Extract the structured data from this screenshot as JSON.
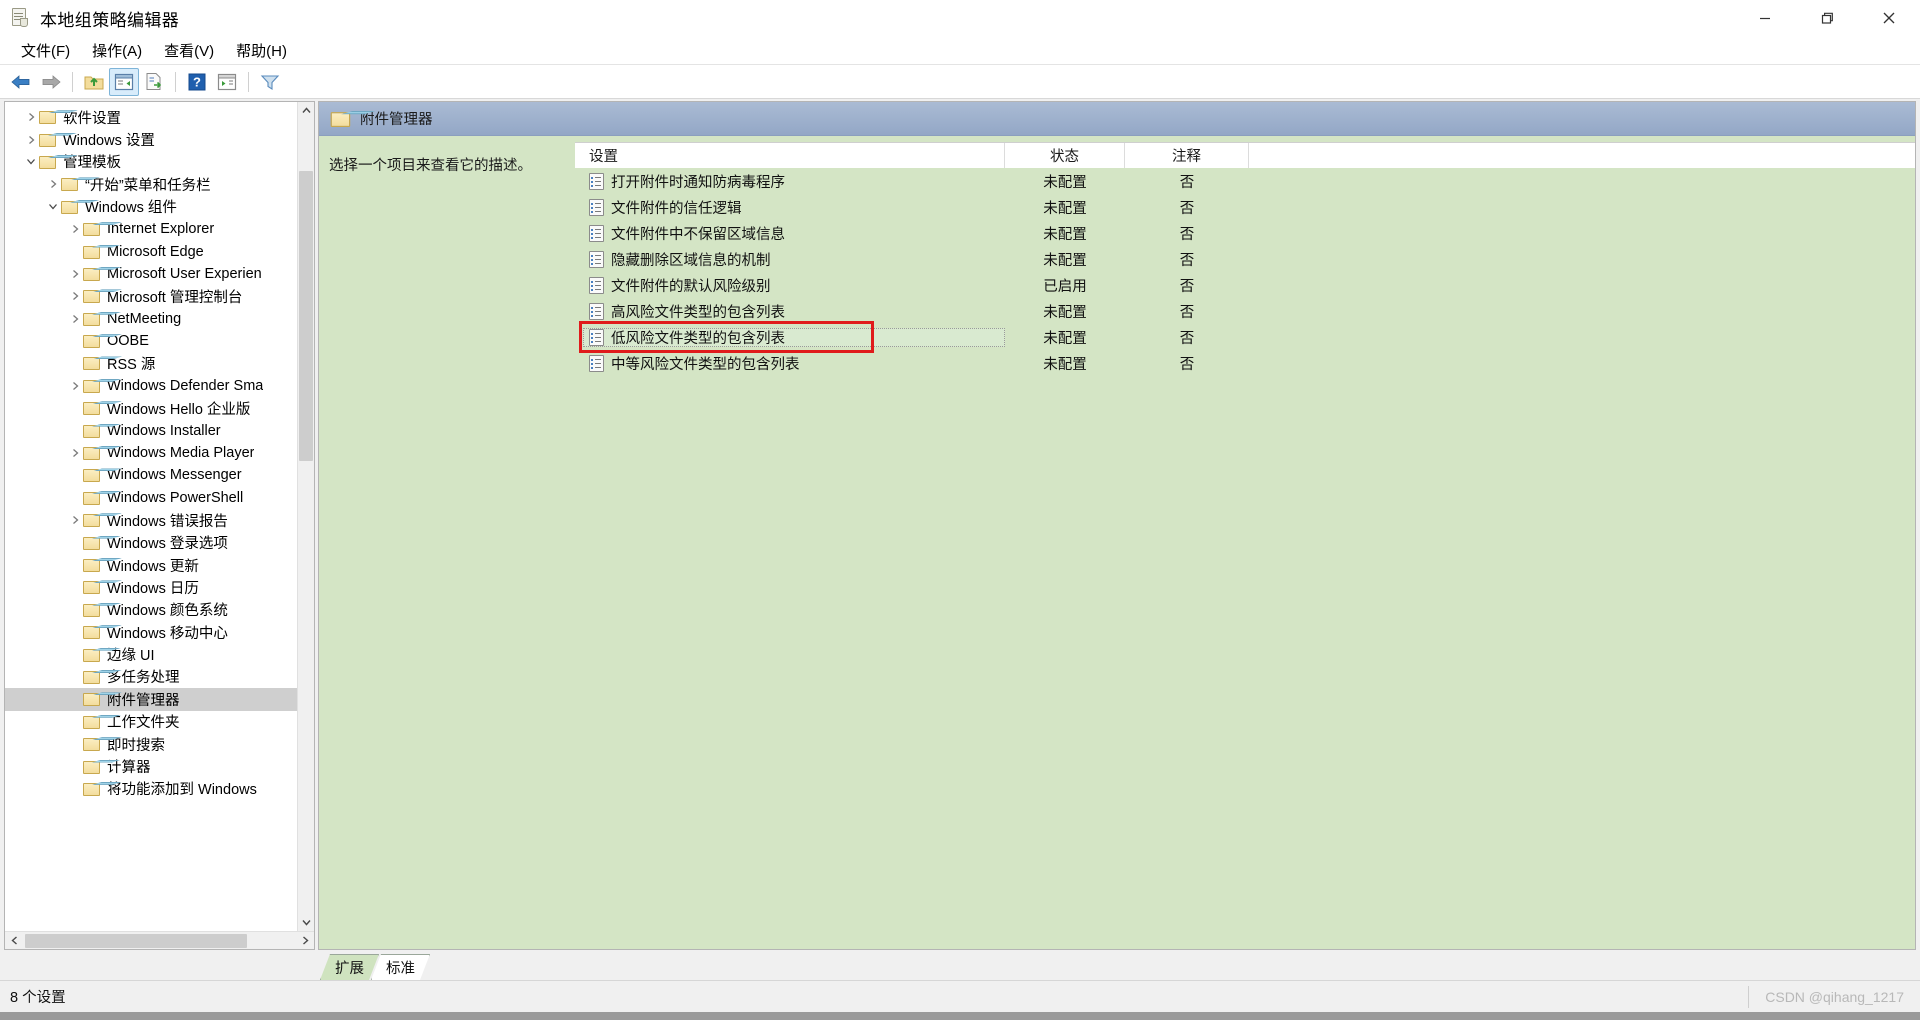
{
  "window": {
    "title": "本地组策略编辑器",
    "icon": "policy-document-icon",
    "minimize_label": "最小化",
    "maximize_label": "还原",
    "close_label": "关闭"
  },
  "menu": {
    "items": [
      {
        "label": "文件(F)",
        "name": "menu-file"
      },
      {
        "label": "操作(A)",
        "name": "menu-action"
      },
      {
        "label": "查看(V)",
        "name": "menu-view"
      },
      {
        "label": "帮助(H)",
        "name": "menu-help"
      }
    ]
  },
  "toolbar": {
    "buttons": [
      {
        "name": "back-button",
        "icon": "arrow-left-icon",
        "active": false
      },
      {
        "name": "forward-button",
        "icon": "arrow-right-icon",
        "active": false
      },
      {
        "name": "up-folder-button",
        "icon": "folder-up-icon",
        "active": false
      },
      {
        "name": "show-hide-tree-button",
        "icon": "console-tree-icon",
        "active": true
      },
      {
        "name": "export-list-button",
        "icon": "export-list-icon",
        "active": false
      },
      {
        "name": "help-button",
        "icon": "question-mark-icon",
        "active": false
      },
      {
        "name": "show-pane-button",
        "icon": "show-pane-icon",
        "active": false
      },
      {
        "name": "filter-button",
        "icon": "filter-funnel-icon",
        "active": false
      }
    ]
  },
  "tree": {
    "nodes": [
      {
        "label": "软件设置",
        "indent": 1,
        "twisty": "collapsed",
        "selected": false
      },
      {
        "label": "Windows 设置",
        "indent": 1,
        "twisty": "collapsed",
        "selected": false
      },
      {
        "label": "管理模板",
        "indent": 1,
        "twisty": "expanded",
        "selected": false
      },
      {
        "label": "“开始”菜单和任务栏",
        "indent": 2,
        "twisty": "collapsed",
        "selected": false
      },
      {
        "label": "Windows 组件",
        "indent": 2,
        "twisty": "expanded",
        "selected": false
      },
      {
        "label": "Internet Explorer",
        "indent": 3,
        "twisty": "collapsed",
        "selected": false
      },
      {
        "label": "Microsoft Edge",
        "indent": 3,
        "twisty": "none",
        "selected": false
      },
      {
        "label": "Microsoft User Experien",
        "indent": 3,
        "twisty": "collapsed",
        "selected": false
      },
      {
        "label": "Microsoft 管理控制台",
        "indent": 3,
        "twisty": "collapsed",
        "selected": false
      },
      {
        "label": "NetMeeting",
        "indent": 3,
        "twisty": "collapsed",
        "selected": false
      },
      {
        "label": "OOBE",
        "indent": 3,
        "twisty": "none",
        "selected": false
      },
      {
        "label": "RSS 源",
        "indent": 3,
        "twisty": "none",
        "selected": false
      },
      {
        "label": "Windows Defender Sma",
        "indent": 3,
        "twisty": "collapsed",
        "selected": false
      },
      {
        "label": "Windows Hello 企业版",
        "indent": 3,
        "twisty": "none",
        "selected": false
      },
      {
        "label": "Windows Installer",
        "indent": 3,
        "twisty": "none",
        "selected": false
      },
      {
        "label": "Windows Media Player",
        "indent": 3,
        "twisty": "collapsed",
        "selected": false
      },
      {
        "label": "Windows Messenger",
        "indent": 3,
        "twisty": "none",
        "selected": false
      },
      {
        "label": "Windows PowerShell",
        "indent": 3,
        "twisty": "none",
        "selected": false
      },
      {
        "label": "Windows 错误报告",
        "indent": 3,
        "twisty": "collapsed",
        "selected": false
      },
      {
        "label": "Windows 登录选项",
        "indent": 3,
        "twisty": "none",
        "selected": false
      },
      {
        "label": "Windows 更新",
        "indent": 3,
        "twisty": "none",
        "selected": false
      },
      {
        "label": "Windows 日历",
        "indent": 3,
        "twisty": "none",
        "selected": false
      },
      {
        "label": "Windows 颜色系统",
        "indent": 3,
        "twisty": "none",
        "selected": false
      },
      {
        "label": "Windows 移动中心",
        "indent": 3,
        "twisty": "none",
        "selected": false
      },
      {
        "label": "边缘 UI",
        "indent": 3,
        "twisty": "none",
        "selected": false
      },
      {
        "label": "多任务处理",
        "indent": 3,
        "twisty": "none",
        "selected": false
      },
      {
        "label": "附件管理器",
        "indent": 3,
        "twisty": "none",
        "selected": true
      },
      {
        "label": "工作文件夹",
        "indent": 3,
        "twisty": "none",
        "selected": false
      },
      {
        "label": "即时搜索",
        "indent": 3,
        "twisty": "none",
        "selected": false
      },
      {
        "label": "计算器",
        "indent": 3,
        "twisty": "none",
        "selected": false
      },
      {
        "label": "将功能添加到 Windows",
        "indent": 3,
        "twisty": "none",
        "selected": false
      }
    ]
  },
  "details": {
    "header_title": "附件管理器",
    "header_icon": "folder-icon",
    "description": "选择一个项目来查看它的描述。",
    "columns": [
      {
        "label": "设置",
        "name": "column-setting"
      },
      {
        "label": "状态",
        "name": "column-state"
      },
      {
        "label": "注释",
        "name": "column-comment"
      }
    ],
    "rows": [
      {
        "setting": "打开附件时通知防病毒程序",
        "state": "未配置",
        "comment": "否",
        "focused": false
      },
      {
        "setting": "文件附件的信任逻辑",
        "state": "未配置",
        "comment": "否",
        "focused": false
      },
      {
        "setting": "文件附件中不保留区域信息",
        "state": "未配置",
        "comment": "否",
        "focused": false
      },
      {
        "setting": "隐藏删除区域信息的机制",
        "state": "未配置",
        "comment": "否",
        "focused": false
      },
      {
        "setting": "文件附件的默认风险级别",
        "state": "已启用",
        "comment": "否",
        "focused": false
      },
      {
        "setting": "高风险文件类型的包含列表",
        "state": "未配置",
        "comment": "否",
        "focused": false
      },
      {
        "setting": "低风险文件类型的包含列表",
        "state": "未配置",
        "comment": "否",
        "focused": true
      },
      {
        "setting": "中等风险文件类型的包含列表",
        "state": "未配置",
        "comment": "否",
        "focused": false
      }
    ]
  },
  "tabs": [
    {
      "label": "扩展",
      "name": "tab-extended",
      "active": true
    },
    {
      "label": "标准",
      "name": "tab-standard",
      "active": false
    }
  ],
  "statusbar": {
    "count_text": "8 个设置",
    "watermark": "CSDN @qihang_1217"
  },
  "colors": {
    "pane_green": "#d4e5c5",
    "header_blue": "#93a7c6",
    "annotation_red": "#e01b1b",
    "selection_gray": "#cfcfcf"
  }
}
